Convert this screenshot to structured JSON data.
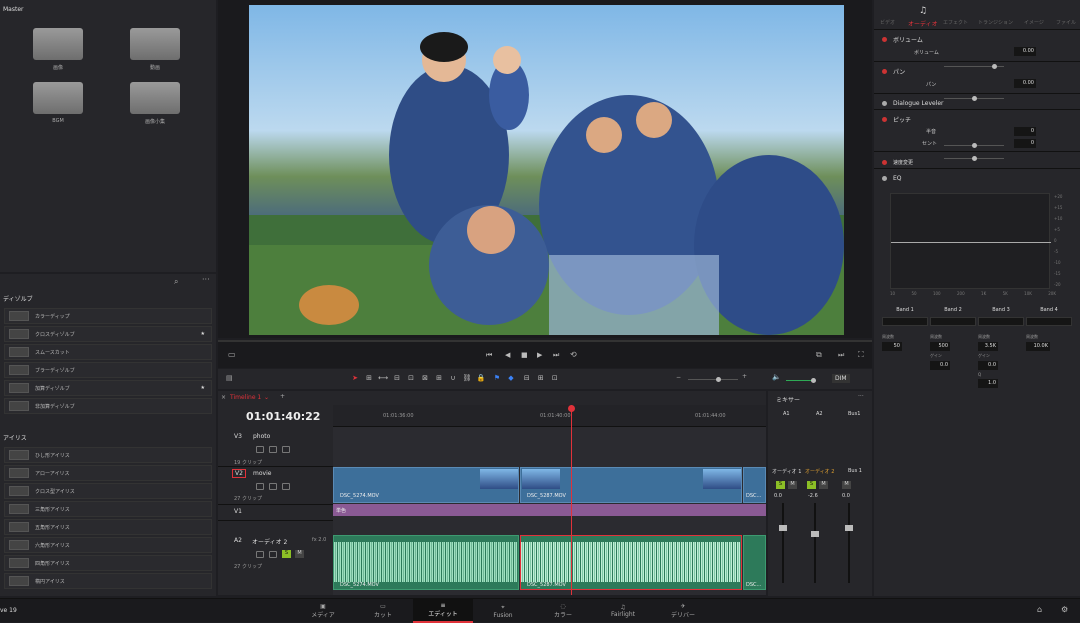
{
  "media_pool": {
    "title": "Master",
    "folders": [
      "画像",
      "動画",
      "BGM",
      "画像小集"
    ]
  },
  "effects": {
    "dissolve_header": "ディゾルブ",
    "dissolves": [
      "カラーディップ",
      "クロスディゾルブ",
      "スムースカット",
      "ブラーディゾルブ",
      "加算ディゾルブ",
      "非加算ディゾルブ"
    ],
    "iris_header": "アイリス",
    "irises": [
      "ひし形アイリス",
      "アローアイリス",
      "クロス型アイリス",
      "三角形アイリス",
      "五角形アイリス",
      "六角形アイリス",
      "四角形アイリス",
      "楕円アイリス"
    ]
  },
  "timeline": {
    "tab": "Timeline 1",
    "timecode": "01:01:40:22",
    "ruler": [
      "01:01:36:00",
      "01:01:40:00",
      "01:01:44:00"
    ],
    "tracks": [
      {
        "id": "V3",
        "name": "photo",
        "count": "19 クリップ"
      },
      {
        "id": "V2",
        "name": "movie",
        "count": "27 クリップ"
      },
      {
        "id": "V1",
        "name": "",
        "count": ""
      },
      {
        "id": "A2",
        "name": "オーディオ 2",
        "count": "27 クリップ",
        "fx": "fx 2.0"
      }
    ],
    "video_clips": [
      "DSC_5274.MOV",
      "DSC_5287.MOV",
      "DSC..."
    ],
    "purple_label": "単色",
    "audio_clips": [
      "DSC_5274.MOV",
      "DSC_5287.MOV",
      "DSC..."
    ],
    "dim": "DIM"
  },
  "mixer": {
    "title": "ミキサー",
    "channels": [
      "A1",
      "A2",
      "Bus1"
    ],
    "labels": [
      "オーディオ 1",
      "オーディオ 2",
      "Bus 1"
    ],
    "levels": [
      "0.0",
      "-2.6",
      "0.0"
    ]
  },
  "inspector": {
    "tabs": [
      "ビデオ",
      "オーディオ",
      "エフェクト",
      "トランジション",
      "イメージ",
      "ファイル"
    ],
    "volume": {
      "header": "ボリューム",
      "label": "ボリューム",
      "value": "0.00"
    },
    "pan": {
      "header": "パン",
      "label": "パン",
      "value": "0.00"
    },
    "dialogue": "Dialogue Leveler",
    "pitch": {
      "header": "ピッチ",
      "semitone": "半音",
      "semitone_val": "0",
      "cent": "セント",
      "cent_val": "0"
    },
    "speed": "速度変更",
    "eq": "EQ",
    "eq_y": [
      "+20",
      "+15",
      "+10",
      "+5",
      "0",
      "-5",
      "-10",
      "-15",
      "-20"
    ],
    "eq_x": [
      "10",
      "50",
      "100",
      "200",
      "1K",
      "5K",
      "10K",
      "20K"
    ],
    "bands": [
      {
        "name": "Band 1",
        "freq_label": "周波数",
        "freq": "50"
      },
      {
        "name": "Band 2",
        "freq_label": "周波数",
        "freq": "500",
        "gain_label": "ゲイン",
        "gain": "0.0"
      },
      {
        "name": "Band 3",
        "freq_label": "周波数",
        "freq": "3.5K",
        "gain_label": "ゲイン",
        "gain": "0.0",
        "q_label": "Q",
        "q": "1.0"
      },
      {
        "name": "Band 4",
        "freq_label": "周波数",
        "freq": "10.0K"
      }
    ]
  },
  "bottom_nav": [
    "メディア",
    "カット",
    "エディット",
    "Fusion",
    "カラー",
    "Fairlight",
    "デリバー"
  ],
  "app_name": "ve 19",
  "colors": {
    "accent_red": "#e0323a",
    "video_clip": "#3d6f9a",
    "audio_clip": "#2d7a5a",
    "purple": "#8a5a94"
  }
}
